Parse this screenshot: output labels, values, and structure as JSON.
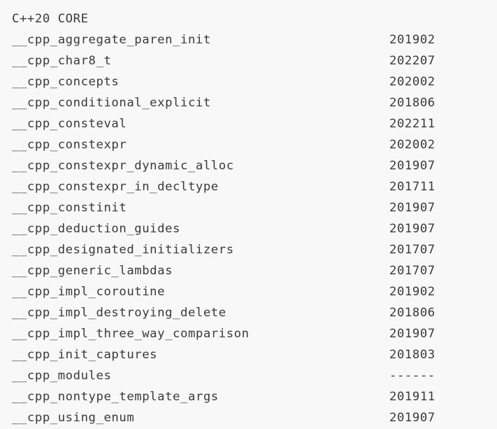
{
  "section": {
    "header": "C++20 CORE"
  },
  "macros": [
    {
      "name": "__cpp_aggregate_paren_init",
      "value": "201902"
    },
    {
      "name": "__cpp_char8_t",
      "value": "202207"
    },
    {
      "name": "__cpp_concepts",
      "value": "202002"
    },
    {
      "name": "__cpp_conditional_explicit",
      "value": "201806"
    },
    {
      "name": "__cpp_consteval",
      "value": "202211"
    },
    {
      "name": "__cpp_constexpr",
      "value": "202002"
    },
    {
      "name": "__cpp_constexpr_dynamic_alloc",
      "value": "201907"
    },
    {
      "name": "__cpp_constexpr_in_decltype",
      "value": "201711"
    },
    {
      "name": "__cpp_constinit",
      "value": "201907"
    },
    {
      "name": "__cpp_deduction_guides",
      "value": "201907"
    },
    {
      "name": "__cpp_designated_initializers",
      "value": "201707"
    },
    {
      "name": "__cpp_generic_lambdas",
      "value": "201707"
    },
    {
      "name": "__cpp_impl_coroutine",
      "value": "201902"
    },
    {
      "name": "__cpp_impl_destroying_delete",
      "value": "201806"
    },
    {
      "name": "__cpp_impl_three_way_comparison",
      "value": "201907"
    },
    {
      "name": "__cpp_init_captures",
      "value": "201803"
    },
    {
      "name": "__cpp_modules",
      "value": "------"
    },
    {
      "name": "__cpp_nontype_template_args",
      "value": "201911"
    },
    {
      "name": "__cpp_using_enum",
      "value": "201907"
    }
  ]
}
